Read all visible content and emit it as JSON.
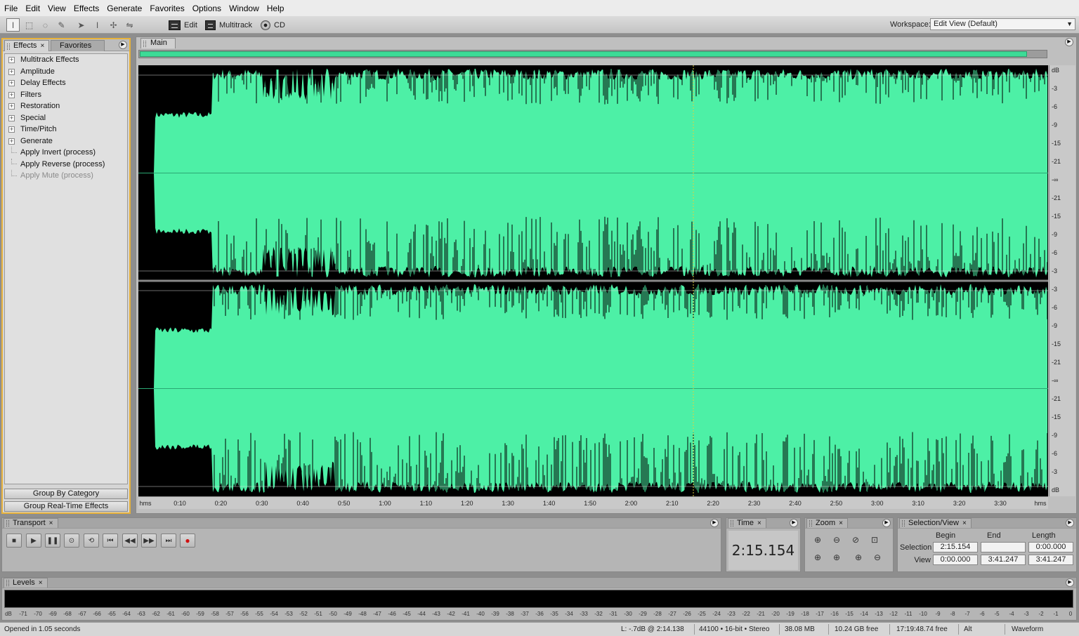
{
  "menu": [
    "File",
    "Edit",
    "View",
    "Effects",
    "Generate",
    "Favorites",
    "Options",
    "Window",
    "Help"
  ],
  "toolbar": {
    "edit_label": "Edit",
    "multitrack_label": "Multitrack",
    "cd_label": "CD",
    "workspace_label": "Workspace:",
    "workspace_value": "Edit View (Default)"
  },
  "effects_panel": {
    "tab_effects": "Effects",
    "tab_favorites": "Favorites",
    "close": "×",
    "items": [
      {
        "label": "Multitrack Effects",
        "expandable": true
      },
      {
        "label": "Amplitude",
        "expandable": true
      },
      {
        "label": "Delay Effects",
        "expandable": true
      },
      {
        "label": "Filters",
        "expandable": true
      },
      {
        "label": "Restoration",
        "expandable": true
      },
      {
        "label": "Special",
        "expandable": true
      },
      {
        "label": "Time/Pitch",
        "expandable": true
      },
      {
        "label": "Generate",
        "expandable": true
      },
      {
        "label": "Apply Invert (process)",
        "expandable": false
      },
      {
        "label": "Apply Reverse (process)",
        "expandable": false
      },
      {
        "label": "Apply Mute (process)",
        "expandable": false,
        "disabled": true
      }
    ],
    "group_by_category": "Group By Category",
    "group_realtime": "Group Real-Time Effects"
  },
  "main": {
    "tab": "Main",
    "colors": {
      "wave": "#4df0a6",
      "bg": "#000000",
      "cursor": "#e0d040"
    },
    "db_labels": [
      "dB",
      "-3",
      "-6",
      "-9",
      "-15",
      "-21",
      "-∞",
      "-21",
      "-15",
      "-9",
      "-6",
      "-3",
      "-3",
      "-6",
      "-9",
      "-15",
      "-21",
      "-∞",
      "-21",
      "-15",
      "-9",
      "-6",
      "-3",
      "dB"
    ],
    "time_labels": [
      "hms",
      "0:10",
      "0:20",
      "0:30",
      "0:40",
      "0:50",
      "1:00",
      "1:10",
      "1:20",
      "1:30",
      "1:40",
      "1:50",
      "2:00",
      "2:10",
      "2:20",
      "2:30",
      "2:40",
      "2:50",
      "3:00",
      "3:10",
      "3:20",
      "3:30",
      "hms"
    ]
  },
  "transport": {
    "tab": "Transport",
    "close": "×"
  },
  "time_panel": {
    "tab": "Time",
    "close": "×",
    "value": "2:15.154"
  },
  "zoom_panel": {
    "tab": "Zoom",
    "close": "×"
  },
  "selection_view": {
    "tab": "Selection/View",
    "close": "×",
    "headers": {
      "begin": "Begin",
      "end": "End",
      "length": "Length"
    },
    "selection_label": "Selection",
    "view_label": "View",
    "selection": {
      "begin": "2:15.154",
      "end": "",
      "length": "0:00.000"
    },
    "view": {
      "begin": "0:00.000",
      "end": "3:41.247",
      "length": "3:41.247"
    }
  },
  "levels": {
    "tab": "Levels",
    "close": "×",
    "ticks": [
      "dB",
      "-71",
      "-70",
      "-69",
      "-68",
      "-67",
      "-66",
      "-65",
      "-64",
      "-63",
      "-62",
      "-61",
      "-60",
      "-59",
      "-58",
      "-57",
      "-56",
      "-55",
      "-54",
      "-53",
      "-52",
      "-51",
      "-50",
      "-49",
      "-48",
      "-47",
      "-46",
      "-45",
      "-44",
      "-43",
      "-42",
      "-41",
      "-40",
      "-39",
      "-38",
      "-37",
      "-36",
      "-35",
      "-34",
      "-33",
      "-32",
      "-31",
      "-30",
      "-29",
      "-28",
      "-27",
      "-26",
      "-25",
      "-24",
      "-23",
      "-22",
      "-21",
      "-20",
      "-19",
      "-18",
      "-17",
      "-16",
      "-15",
      "-14",
      "-13",
      "-12",
      "-11",
      "-10",
      "-9",
      "-8",
      "-7",
      "-6",
      "-5",
      "-4",
      "-3",
      "-2",
      "-1",
      "0"
    ]
  },
  "status": {
    "opened": "Opened in 1.05 seconds",
    "level": "L: -.7dB @   2:14.138",
    "format": "44100 • 16-bit • Stereo",
    "size": "38.08 MB",
    "free": "10.24 GB free",
    "time_free": "17:19:48.74 free",
    "alt": "Alt",
    "view": "Waveform"
  }
}
